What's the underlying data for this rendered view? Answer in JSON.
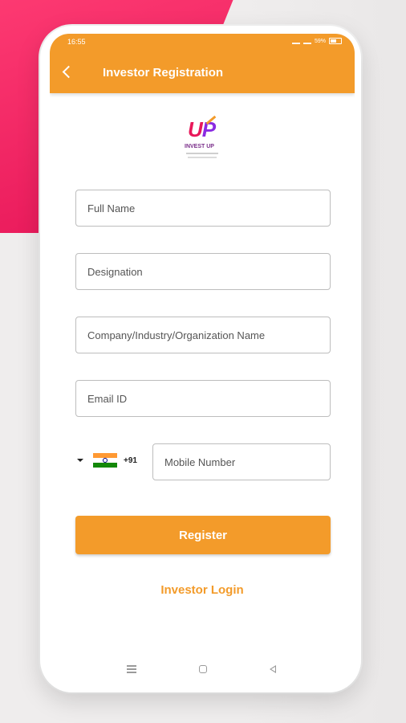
{
  "status_bar": {
    "time": "16:55",
    "battery": "59%"
  },
  "header": {
    "title": "Investor Registration"
  },
  "logo": {
    "brand": "UP",
    "tagline": "INVEST UP"
  },
  "form": {
    "full_name": {
      "placeholder": "Full Name",
      "value": ""
    },
    "designation": {
      "placeholder": "Designation",
      "value": ""
    },
    "company": {
      "placeholder": "Company/Industry/Organization Name",
      "value": ""
    },
    "email": {
      "placeholder": "Email ID",
      "value": ""
    },
    "country_code": "+91",
    "mobile": {
      "placeholder": "Mobile Number",
      "value": ""
    }
  },
  "actions": {
    "register_label": "Register",
    "login_link": "Investor Login"
  },
  "colors": {
    "primary": "#f39b2a",
    "accent_pink": "#e8185a"
  },
  "icons": {
    "back": "back-chevron-icon",
    "flag": "india-flag-icon",
    "dropdown": "dropdown-caret-icon"
  }
}
